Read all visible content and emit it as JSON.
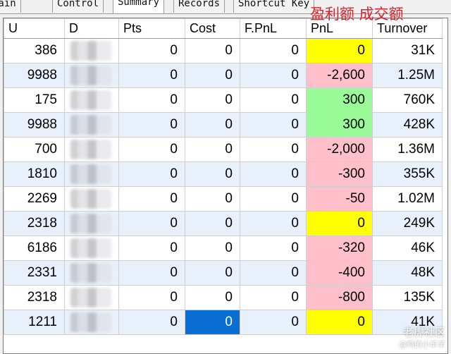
{
  "tabs": [
    {
      "label": "Main"
    },
    {
      "label": "Control"
    },
    {
      "label": "Summary"
    },
    {
      "label": "Records"
    },
    {
      "label": "Shortcut Key"
    }
  ],
  "active_tab": "Summary",
  "annotation": "盈利额 成交额",
  "columns": {
    "u": "U",
    "d": "D",
    "pts": "Pts",
    "cost": "Cost",
    "fpnl": "F.PnL",
    "pnl": "PnL",
    "turnover": "Turnover"
  },
  "rows": [
    {
      "u": "386",
      "pts": "0",
      "cost": "0",
      "fpnl": "0",
      "pnl": "0",
      "pnl_color": "#ffff00",
      "turnover": "31K"
    },
    {
      "u": "9988",
      "pts": "0",
      "cost": "0",
      "fpnl": "0",
      "pnl": "-2,600",
      "pnl_color": "#ffc0cb",
      "turnover": "1.25M"
    },
    {
      "u": "175",
      "pts": "0",
      "cost": "0",
      "fpnl": "0",
      "pnl": "300",
      "pnl_color": "#98fb98",
      "turnover": "760K"
    },
    {
      "u": "9988",
      "pts": "0",
      "cost": "0",
      "fpnl": "0",
      "pnl": "300",
      "pnl_color": "#98fb98",
      "turnover": "428K"
    },
    {
      "u": "700",
      "pts": "0",
      "cost": "0",
      "fpnl": "0",
      "pnl": "-2,000",
      "pnl_color": "#ffc0cb",
      "turnover": "1.36M"
    },
    {
      "u": "1810",
      "pts": "0",
      "cost": "0",
      "fpnl": "0",
      "pnl": "-300",
      "pnl_color": "#ffc0cb",
      "turnover": "355K"
    },
    {
      "u": "2269",
      "pts": "0",
      "cost": "0",
      "fpnl": "0",
      "pnl": "-50",
      "pnl_color": "#ffc0cb",
      "turnover": "1.02M"
    },
    {
      "u": "2318",
      "pts": "0",
      "cost": "0",
      "fpnl": "0",
      "pnl": "0",
      "pnl_color": "#ffff00",
      "turnover": "249K"
    },
    {
      "u": "6186",
      "pts": "0",
      "cost": "0",
      "fpnl": "0",
      "pnl": "-320",
      "pnl_color": "#ffc0cb",
      "turnover": "46K"
    },
    {
      "u": "2331",
      "pts": "0",
      "cost": "0",
      "fpnl": "0",
      "pnl": "-400",
      "pnl_color": "#ffc0cb",
      "turnover": "48K"
    },
    {
      "u": "2318",
      "pts": "0",
      "cost": "0",
      "fpnl": "0",
      "pnl": "-800",
      "pnl_color": "#ffc0cb",
      "turnover": "135K"
    },
    {
      "u": "1211",
      "pts": "0",
      "cost": "0",
      "fpnl": "0",
      "pnl": "0",
      "pnl_color": "#ffff00",
      "turnover": "41K",
      "cost_selected": true
    }
  ],
  "watermark": {
    "line1": "老虎社区",
    "line2": "@鸡的小羊羊"
  },
  "colors": {
    "selection": "#0a6fd4",
    "alt_row": "#e8f1fb",
    "annotation": "#e0202a"
  }
}
